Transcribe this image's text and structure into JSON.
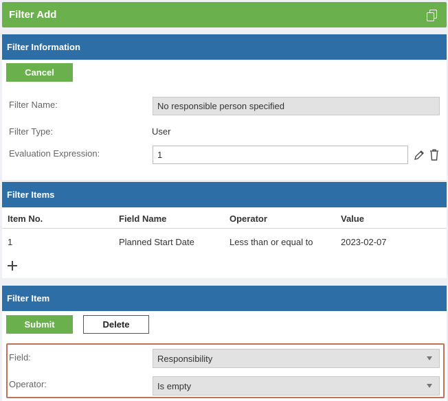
{
  "window": {
    "title": "Filter Add",
    "copy_icon": "copy-icon"
  },
  "filter_information": {
    "header": "Filter Information",
    "cancel_label": "Cancel",
    "filter_name_label": "Filter Name:",
    "filter_name_value": "No responsible person specified",
    "filter_type_label": "Filter Type:",
    "filter_type_value": "User",
    "evaluation_label": "Evaluation Expression:",
    "evaluation_value": "1",
    "edit_icon": "pencil-icon",
    "delete_icon": "trash-icon"
  },
  "filter_items": {
    "header": "Filter Items",
    "columns": [
      "Item No.",
      "Field Name",
      "Operator",
      "Value"
    ],
    "rows": [
      {
        "item_no": "1",
        "field_name": "Planned Start Date",
        "operator": "Less than or equal to",
        "value": "2023-02-07"
      }
    ],
    "add_icon": "plus-icon"
  },
  "filter_item": {
    "header": "Filter Item",
    "submit_label": "Submit",
    "delete_label": "Delete",
    "field_label": "Field:",
    "field_value": "Responsibility",
    "operator_label": "Operator:",
    "operator_value": "Is empty"
  },
  "colors": {
    "title_green": "#6ab04c",
    "header_blue": "#2e6ea6",
    "highlight": "#c0705a"
  }
}
